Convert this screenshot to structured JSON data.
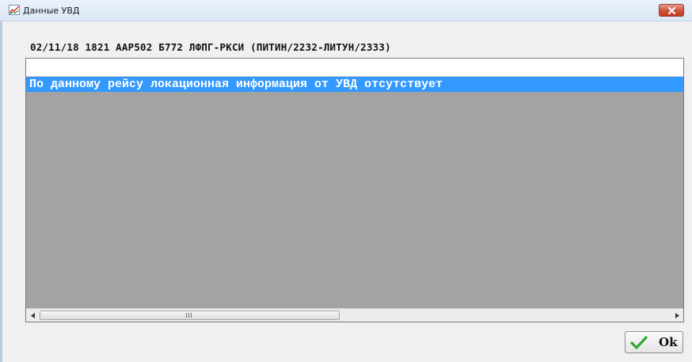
{
  "window": {
    "title": "Данные УВД",
    "close_label": "close"
  },
  "flight": {
    "header": "02/11/18 1821 AAP502 Б772 ЛФПГ-РКСИ (ПИТИН/2232-ЛИТУН/2333)"
  },
  "list": {
    "rows": [
      {
        "text": "По данному рейсу локационная информация от УВД отсутствует",
        "selected": true
      }
    ]
  },
  "scrollbar": {
    "grip": "III"
  },
  "buttons": {
    "ok_label": "Ok"
  },
  "colors": {
    "selection": "#3399ff",
    "panel_background": "#a3a3a3",
    "close_button": "#c4391f",
    "ok_check": "#2eaa2e"
  },
  "icons": [
    "chart-app-icon",
    "close-icon",
    "scroll-left-icon",
    "scroll-right-icon",
    "checkmark-icon"
  ]
}
